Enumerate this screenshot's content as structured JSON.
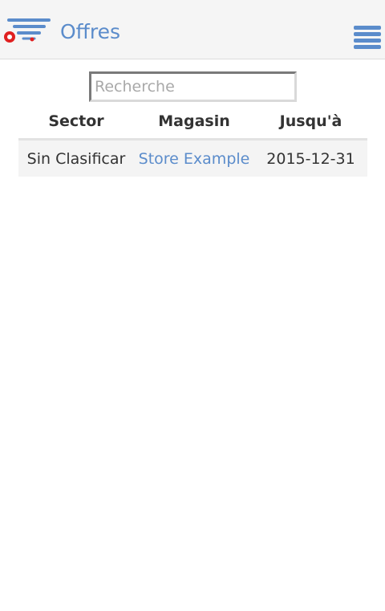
{
  "header": {
    "title": "Offres",
    "logo_icon": "shopping-cart-logo-icon",
    "menu_icon": "hamburger-menu-icon",
    "accent_color": "#5b8ccb",
    "logo_dot_color": "#e02020"
  },
  "search": {
    "placeholder": "Recherche",
    "value": ""
  },
  "table": {
    "columns": [
      "Sector",
      "Magasin",
      "Jusqu'à"
    ],
    "rows": [
      {
        "sector": "Sin Clasificar",
        "store": "Store Example",
        "until": "2015-12-31"
      }
    ]
  }
}
